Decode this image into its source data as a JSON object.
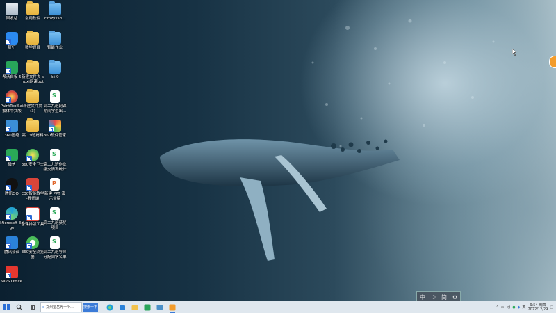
{
  "desktop": {
    "icons": [
      {
        "label": "回收站",
        "type": "recycle"
      },
      {
        "label": "常用软件",
        "type": "folder"
      },
      {
        "label": "cznzyxsd...",
        "type": "folder-blue"
      },
      {
        "label": "钉钉",
        "type": "dingtalk"
      },
      {
        "label": "数学题目",
        "type": "folder"
      },
      {
        "label": "智能作业",
        "type": "folder-blue"
      },
      {
        "label": "希沃白板 5",
        "type": "easinote"
      },
      {
        "label": "新建文件夹 shuxi网课ppt",
        "type": "folder"
      },
      {
        "label": "k+9",
        "type": "folder-blue"
      },
      {
        "label": "PaintToolSai 繁体中文版",
        "type": "sai"
      },
      {
        "label": "新建文件夹 (3)",
        "type": "folder"
      },
      {
        "label": "高二九班网课 期间学生出...",
        "type": "doc-s"
      },
      {
        "label": "360压缩",
        "type": "zip360"
      },
      {
        "label": "高二9班材料",
        "type": "folder"
      },
      {
        "label": "360软件管家",
        "type": "softmgr"
      },
      {
        "label": "微信",
        "type": "wechat"
      },
      {
        "label": "360安全卫士",
        "type": "safe360"
      },
      {
        "label": "高二九班作业 缴交情况统计",
        "type": "doc-s"
      },
      {
        "label": "腾讯QQ",
        "type": "qq"
      },
      {
        "label": "C30智能教学 -教师端",
        "type": "c30"
      },
      {
        "label": "新建 PPT 演示文稿",
        "type": "doc-p"
      },
      {
        "label": "Microsoft Edge",
        "type": "edge"
      },
      {
        "label": "备课排版工具",
        "type": "tool"
      },
      {
        "label": "高二九班获奖 项目",
        "type": "doc-s"
      },
      {
        "label": "腾讯会议",
        "type": "meeting"
      },
      {
        "label": "360安全浏览器",
        "type": "browser360"
      },
      {
        "label": "高二九班导师 分配同学名单",
        "type": "doc-s"
      },
      {
        "label": "WPS Office",
        "type": "wps"
      }
    ]
  },
  "ime_bar": {
    "items": [
      "中",
      "☽",
      "简",
      "⚙"
    ]
  },
  "taskbar": {
    "search_value": "郑州望岳光十个...",
    "search_button": "搜索一下",
    "clock": {
      "time": "9:54 周四",
      "date": "2022/12/29"
    },
    "tray_lang": "英"
  },
  "colors": {
    "taskbar": "#dfe7ee",
    "accent": "#3b7bd8",
    "side_button": "#f39c2b"
  }
}
